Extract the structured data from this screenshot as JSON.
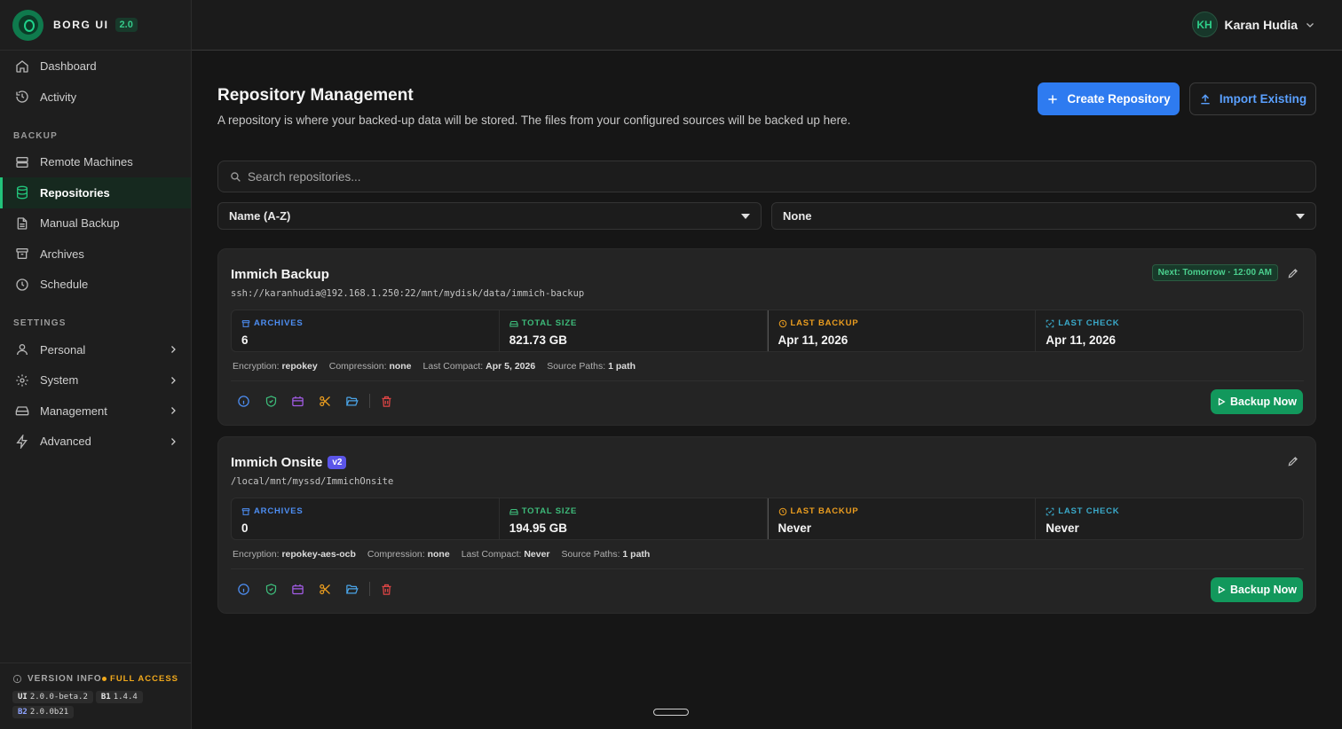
{
  "app": {
    "name": "BORG UI",
    "version": "2.0"
  },
  "sidebar": {
    "top_items": [
      {
        "label": "Dashboard",
        "icon": "home-icon"
      },
      {
        "label": "Activity",
        "icon": "history-icon"
      }
    ],
    "backup_section": {
      "title": "BACKUP",
      "items": [
        {
          "label": "Remote Machines",
          "icon": "server-icon"
        },
        {
          "label": "Repositories",
          "icon": "database-icon",
          "active": true
        },
        {
          "label": "Manual Backup",
          "icon": "file-icon"
        },
        {
          "label": "Archives",
          "icon": "archive-icon"
        },
        {
          "label": "Schedule",
          "icon": "clock-icon"
        }
      ]
    },
    "settings_section": {
      "title": "SETTINGS",
      "items": [
        {
          "label": "Personal",
          "icon": "user-icon"
        },
        {
          "label": "System",
          "icon": "gear-icon"
        },
        {
          "label": "Management",
          "icon": "drive-icon"
        },
        {
          "label": "Advanced",
          "icon": "lightning-icon"
        }
      ]
    },
    "version_info": {
      "title": "VERSION INFO",
      "access": "FULL ACCESS",
      "ui_label": "UI",
      "ui_version": "2.0.0-beta.2",
      "b1_label": "B1",
      "b1_version": "1.4.4",
      "b2_label": "B2",
      "b2_version": "2.0.0b21"
    }
  },
  "header": {
    "user_initials": "KH",
    "user_name": "Karan Hudia"
  },
  "page": {
    "title": "Repository Management",
    "description": "A repository is where your backed-up data will be stored. The files from your configured sources will be backed up here.",
    "create_label": "Create Repository",
    "import_label": "Import Existing",
    "search_placeholder": "Search repositories...",
    "sort_value": "Name (A-Z)",
    "group_value": "None"
  },
  "stat_labels": {
    "archives": "ARCHIVES",
    "total_size": "TOTAL SIZE",
    "last_backup": "LAST BACKUP",
    "last_check": "LAST CHECK"
  },
  "meta_labels": {
    "encryption": "Encryption:",
    "compression": "Compression:",
    "last_compact": "Last Compact:",
    "source_paths": "Source Paths:"
  },
  "backup_now_label": "Backup Now",
  "repositories": [
    {
      "name": "Immich Backup",
      "badge": "",
      "path": "ssh://karanhudia@192.168.1.250:22/mnt/mydisk/data/immich-backup",
      "next": "Next: Tomorrow · 12:00 AM",
      "archives": "6",
      "total_size": "821.73 GB",
      "last_backup": "Apr 11, 2026",
      "last_check": "Apr 11, 2026",
      "encryption": "repokey",
      "compression": "none",
      "last_compact": "Apr 5, 2026",
      "source_paths": "1 path"
    },
    {
      "name": "Immich Onsite",
      "badge": "v2",
      "path": "/local/mnt/myssd/ImmichOnsite",
      "next": "",
      "archives": "0",
      "total_size": "194.95 GB",
      "last_backup": "Never",
      "last_check": "Never",
      "encryption": "repokey-aes-ocb",
      "compression": "none",
      "last_compact": "Never",
      "source_paths": "1 path"
    }
  ],
  "colors": {
    "accent_green": "#22c47b",
    "primary_blue": "#2e7bf0",
    "backup_green": "#12985c",
    "badge_purple": "#5b55e8"
  }
}
